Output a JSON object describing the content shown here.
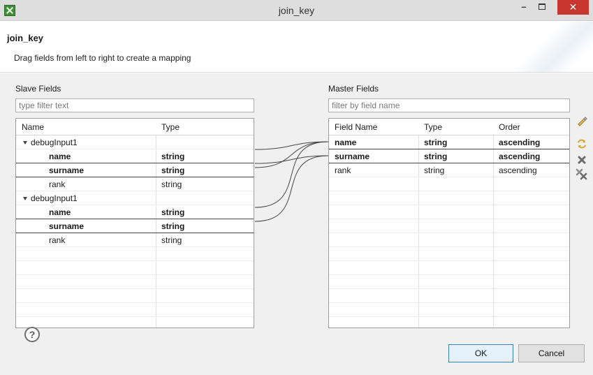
{
  "window": {
    "title": "join_key"
  },
  "header": {
    "title": "join_key",
    "description": "Drag fields from left to right to create a mapping"
  },
  "slave": {
    "label": "Slave Fields",
    "filter_placeholder": "type filter text",
    "columns": [
      "Name",
      "Type"
    ],
    "groups": [
      {
        "name": "debugInput1",
        "fields": [
          {
            "name": "name",
            "type": "string",
            "mapped": true
          },
          {
            "name": "surname",
            "type": "string",
            "mapped": true
          },
          {
            "name": "rank",
            "type": "string",
            "mapped": false
          }
        ]
      },
      {
        "name": "debugInput1",
        "fields": [
          {
            "name": "name",
            "type": "string",
            "mapped": true
          },
          {
            "name": "surname",
            "type": "string",
            "mapped": true
          },
          {
            "name": "rank",
            "type": "string",
            "mapped": false
          }
        ]
      }
    ]
  },
  "master": {
    "label": "Master Fields",
    "filter_placeholder": "filter by field name",
    "columns": [
      "Field Name",
      "Type",
      "Order"
    ],
    "rows": [
      {
        "name": "name",
        "type": "string",
        "order": "ascending",
        "mapped": true
      },
      {
        "name": "surname",
        "type": "string",
        "order": "ascending",
        "mapped": true
      },
      {
        "name": "rank",
        "type": "string",
        "order": "ascending",
        "mapped": false
      }
    ]
  },
  "side_icons": [
    "auto-map-icon",
    "remap-icon",
    "delete-mapping-icon",
    "delete-all-mappings-icon"
  ],
  "buttons": {
    "ok": "OK",
    "cancel": "Cancel",
    "help": "?"
  }
}
